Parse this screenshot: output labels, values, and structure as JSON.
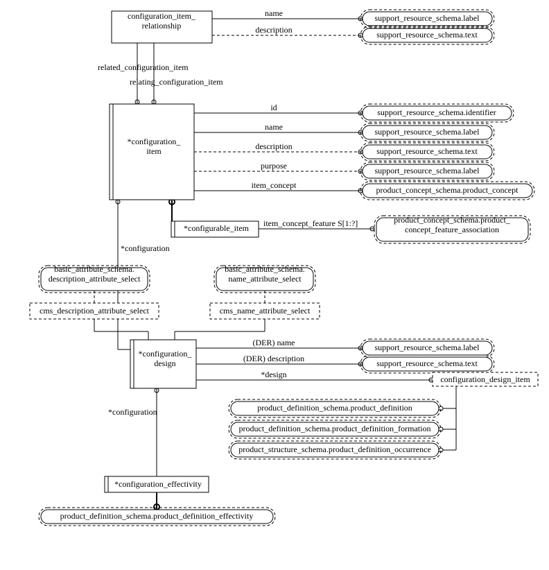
{
  "entities": {
    "cir": "configuration_item_\nrelationship",
    "ci": "*configuration_\nitem",
    "cfi": "*configurable_item",
    "bas_desc": "basic_attribute_schema.\ndescription_attribute_select",
    "bas_name": "basic_attribute_schema.\nname_attribute_select",
    "cms_desc": "cms_description_attribute_select",
    "cms_name": "cms_name_attribute_select",
    "cd": "*configuration_\ndesign",
    "ce": "*configuration_effectivity",
    "pdse": "product_definition_schema.product_definition_effectivity",
    "cdi": "configuration_design_item",
    "pcs_feat": "product_concept_schema.product_\nconcept_feature_association"
  },
  "attrs": {
    "cir_name": "name",
    "cir_desc": "description",
    "rel_ci": "related_configuration_item",
    "relating_ci": "relating_configuration_item",
    "ci_id": "id",
    "ci_name": "name",
    "ci_desc": "description",
    "ci_purpose": "purpose",
    "ci_item_concept": "item_concept",
    "cfi_feat": "item_concept_feature S[1:?]",
    "cd_cfg": "*configuration",
    "cd_name": "(DER) name",
    "cd_desc": "(DER) description",
    "cd_design": "*design",
    "ce_cfg": "*configuration"
  },
  "refs": {
    "srs_label": "support_resource_schema.label",
    "srs_text": "support_resource_schema.text",
    "srs_id": "support_resource_schema.identifier",
    "pcs_pc": "product_concept_schema.product_concept",
    "pds_pd": "product_definition_schema.product_definition",
    "pds_pdf": "product_definition_schema.product_definition_formation",
    "pss_pdo": "product_structure_schema.product_definition_occurrence"
  }
}
